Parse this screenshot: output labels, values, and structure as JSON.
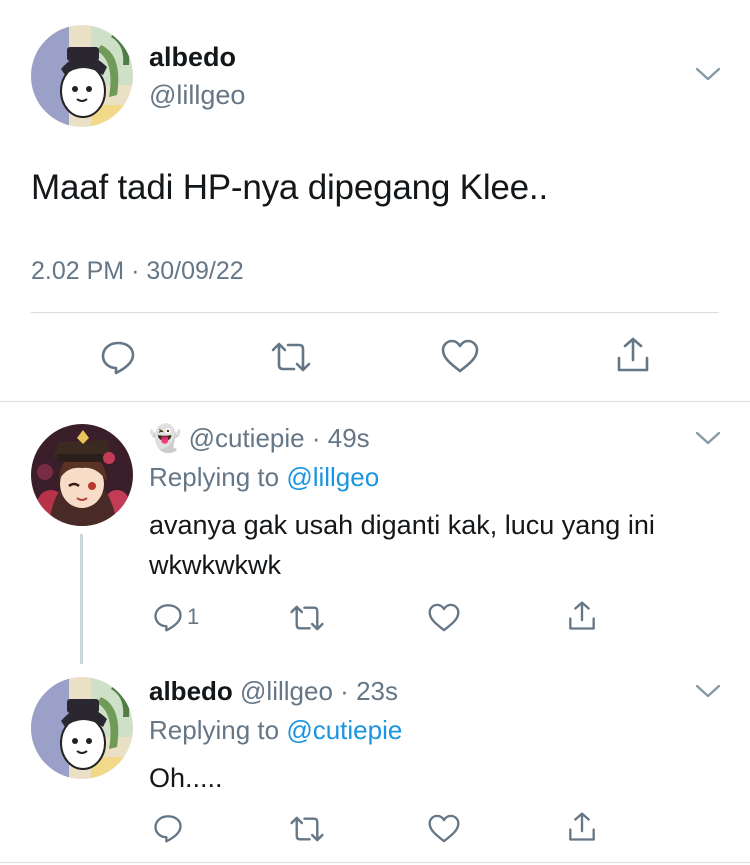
{
  "main_tweet": {
    "name": "albedo",
    "handle": "@lillgeo",
    "text": "Maaf tadi HP-nya dipegang Klee..",
    "time": "2.02 PM",
    "separator": "·",
    "date": "30/09/22",
    "avatar_icon": "albedo-avatar-icon",
    "actions": [
      "reply-icon",
      "retweet-icon",
      "like-icon",
      "share-icon"
    ]
  },
  "reply1": {
    "emoji": "👻",
    "handle": "@cutiepie",
    "separator": "·",
    "age": "49s",
    "replying_prefix": "Replying to",
    "replying_handle": "@lillgeo",
    "text_line1": "avanya gak usah diganti kak, lucu yang ini",
    "text_line2": "wkwkwkwk",
    "reply_count": "1",
    "avatar_icon": "hutao-avatar-icon"
  },
  "reply2": {
    "name": "albedo",
    "handle": "@lillgeo",
    "separator": "·",
    "age": "23s",
    "replying_prefix": "Replying to",
    "replying_handle": "@cutiepie",
    "text": "Oh.....",
    "avatar_icon": "albedo-avatar-icon"
  },
  "colors": {
    "text": "#14171a",
    "secondary": "#657786",
    "link": "#1b95e0",
    "divider": "#d8dde1"
  }
}
